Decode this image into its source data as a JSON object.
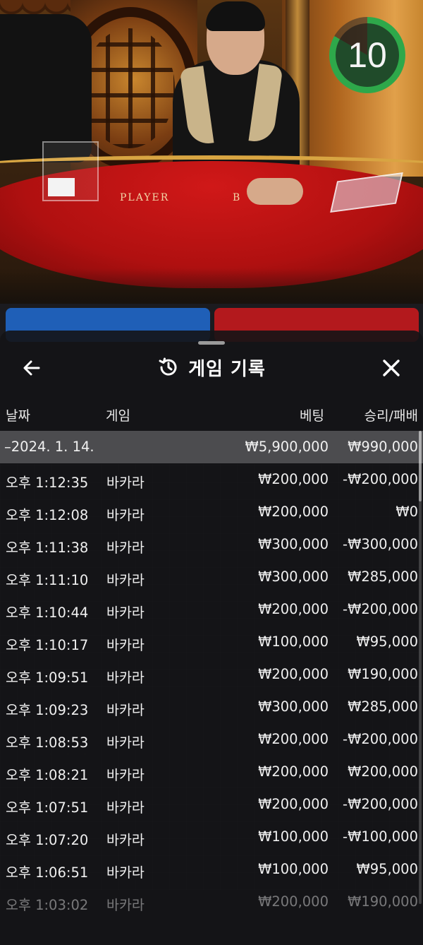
{
  "stream": {
    "table_label_player": "PLAYER",
    "table_label_banker": "B",
    "timer_value": "10"
  },
  "sheet": {
    "title": "게임 기록",
    "columns": {
      "date": "날짜",
      "game": "게임",
      "bet": "베팅",
      "result": "승리/패배"
    },
    "date_group": {
      "date": "–2024. 1. 14.",
      "bet": "₩5,900,000",
      "result": "₩990,000"
    },
    "rows": [
      {
        "time": "오후 1:12:35",
        "game": "바카라",
        "bet": "₩200,000",
        "result": "-₩200,000"
      },
      {
        "time": "오후 1:12:08",
        "game": "바카라",
        "bet": "₩200,000",
        "result": "₩0"
      },
      {
        "time": "오후 1:11:38",
        "game": "바카라",
        "bet": "₩300,000",
        "result": "-₩300,000"
      },
      {
        "time": "오후 1:11:10",
        "game": "바카라",
        "bet": "₩300,000",
        "result": "₩285,000"
      },
      {
        "time": "오후 1:10:44",
        "game": "바카라",
        "bet": "₩200,000",
        "result": "-₩200,000"
      },
      {
        "time": "오후 1:10:17",
        "game": "바카라",
        "bet": "₩100,000",
        "result": "₩95,000"
      },
      {
        "time": "오후 1:09:51",
        "game": "바카라",
        "bet": "₩200,000",
        "result": "₩190,000"
      },
      {
        "time": "오후 1:09:23",
        "game": "바카라",
        "bet": "₩300,000",
        "result": "₩285,000"
      },
      {
        "time": "오후 1:08:53",
        "game": "바카라",
        "bet": "₩200,000",
        "result": "-₩200,000"
      },
      {
        "time": "오후 1:08:21",
        "game": "바카라",
        "bet": "₩200,000",
        "result": "₩200,000"
      },
      {
        "time": "오후 1:07:51",
        "game": "바카라",
        "bet": "₩200,000",
        "result": "-₩200,000"
      },
      {
        "time": "오후 1:07:20",
        "game": "바카라",
        "bet": "₩100,000",
        "result": "-₩100,000"
      },
      {
        "time": "오후 1:06:51",
        "game": "바카라",
        "bet": "₩100,000",
        "result": "₩95,000"
      },
      {
        "time": "오후 1:03:02",
        "game": "바카라",
        "bet": "₩200,000",
        "result": "₩190,000"
      }
    ]
  },
  "icons": {
    "back": "arrow-left-icon",
    "close": "close-icon",
    "title": "history-icon"
  },
  "colors": {
    "timer_ring": "#2ea84a",
    "date_row_bg": "#4c4c4f",
    "sheet_bg": "#141416"
  }
}
